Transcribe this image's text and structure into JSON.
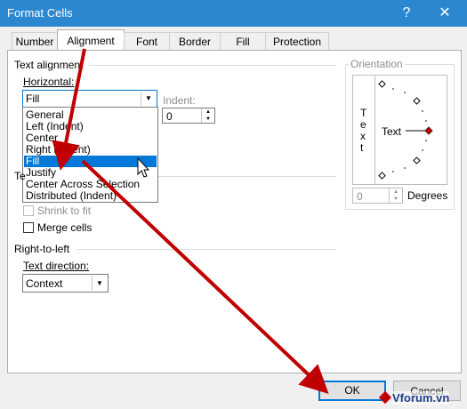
{
  "window": {
    "title": "Format Cells",
    "help_icon": "question-mark-icon",
    "close_icon": "close-icon"
  },
  "tabs": [
    {
      "label": "Number"
    },
    {
      "label": "Alignment"
    },
    {
      "label": "Font"
    },
    {
      "label": "Border"
    },
    {
      "label": "Fill"
    },
    {
      "label": "Protection"
    }
  ],
  "text_alignment": {
    "section_label": "Text alignment",
    "horizontal_label": "Horizontal:",
    "horizontal_value": "Fill",
    "horizontal_options": [
      "General",
      "Left (Indent)",
      "Center",
      "Right (Indent)",
      "Fill",
      "Justify",
      "Center Across Selection",
      "Distributed (Indent)"
    ],
    "selected_option": "Fill",
    "indent_label": "Indent:",
    "indent_value": "0",
    "vertical_label_partial": "Te"
  },
  "text_control": {
    "shrink_label": "Shrink to fit",
    "merge_label": "Merge cells"
  },
  "right_to_left": {
    "section_label": "Right-to-left",
    "direction_label": "Text direction:",
    "direction_value": "Context"
  },
  "orientation": {
    "section_label": "Orientation",
    "vertical_text": [
      "T",
      "e",
      "x",
      "t"
    ],
    "horizontal_text": "Text",
    "degrees_value": "0",
    "degrees_label": "Degrees"
  },
  "buttons": {
    "ok": "OK",
    "cancel": "Cancel"
  },
  "watermark": "Vforum.vn",
  "colors": {
    "titlebar": "#2b87d0",
    "selection": "#0078d7",
    "arrow": "#c00000",
    "orientation_marker": "#c00000"
  }
}
